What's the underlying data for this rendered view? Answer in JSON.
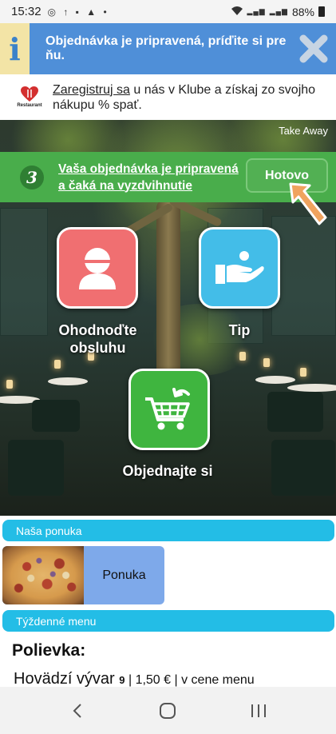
{
  "status_bar": {
    "time": "15:32",
    "left_icons": "◎ ↑ ▪ ▲ •",
    "network_label_1": "Vo))\nLTE1",
    "network_label_2": "Vo))\nLTE2",
    "battery": "88%"
  },
  "notification": {
    "info_icon": "i",
    "text": "Objednávka je pripravená, príďite si pre ňu.",
    "close_icon": "close-icon"
  },
  "club_banner": {
    "logo_text": "Restaurant",
    "link_text": "Zaregistruj sa",
    "text": " u nás v Klube a získaj zo svojho nákupu % spať."
  },
  "hero": {
    "takeaway_label": "Take Away",
    "order_number": "3",
    "order_status": "Vaša objednávka je pripravená a čaká na vyzdvihnutie",
    "done_button": "Hotovo",
    "tiles": {
      "rate": {
        "label_line1": "Ohodnoďte",
        "label_line2": "obsluhu",
        "color": "#f06f71"
      },
      "tip": {
        "label": "Tip",
        "color": "#43bde8"
      },
      "order": {
        "label": "Objednajte si",
        "color": "#3fb53f"
      }
    }
  },
  "offer_section": {
    "title": "Naša ponuka",
    "card_label": "Ponuka"
  },
  "weekly_section": {
    "title": "Týždenné menu"
  },
  "menu": {
    "heading": "Polievka:",
    "item_name": "Hovädzí vývar",
    "item_number": "9",
    "item_meta": " | 1,50 € | v cene menu"
  },
  "colors": {
    "notification_bg": "#4f8fd8",
    "order_bar_bg": "#49ad4b",
    "section_bar_bg": "#23bde6",
    "offer_card_bg": "#7ea9ea"
  }
}
